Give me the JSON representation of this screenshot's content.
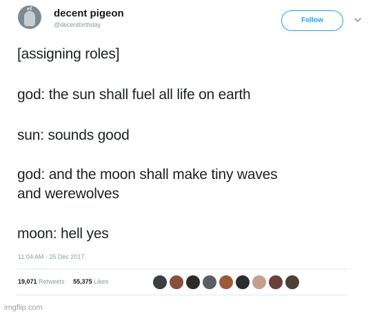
{
  "user": {
    "avatar_text": "ef",
    "display_name": "decent pigeon",
    "handle": "@decentbirthday"
  },
  "follow_label": "Follow",
  "lines": [
    "[assigning roles]",
    "god: the sun shall fuel all life on earth",
    "sun: sounds good",
    "god: and the moon shall make tiny waves",
    "and werewolves",
    "moon: hell yes"
  ],
  "timestamp": "11:04 AM - 25 Dec 2017",
  "stats": {
    "retweets_count": "19,071",
    "retweets_label": "Retweets",
    "likes_count": "55,375",
    "likes_label": "Likes"
  },
  "liker_colors": [
    "#3b3f42",
    "#8a4f3c",
    "#2f2a28",
    "#5a5f64",
    "#9c5a3a",
    "#2a2c30",
    "#c2a090",
    "#6c3f3a",
    "#4a4036"
  ],
  "watermark": "imgflip.com"
}
